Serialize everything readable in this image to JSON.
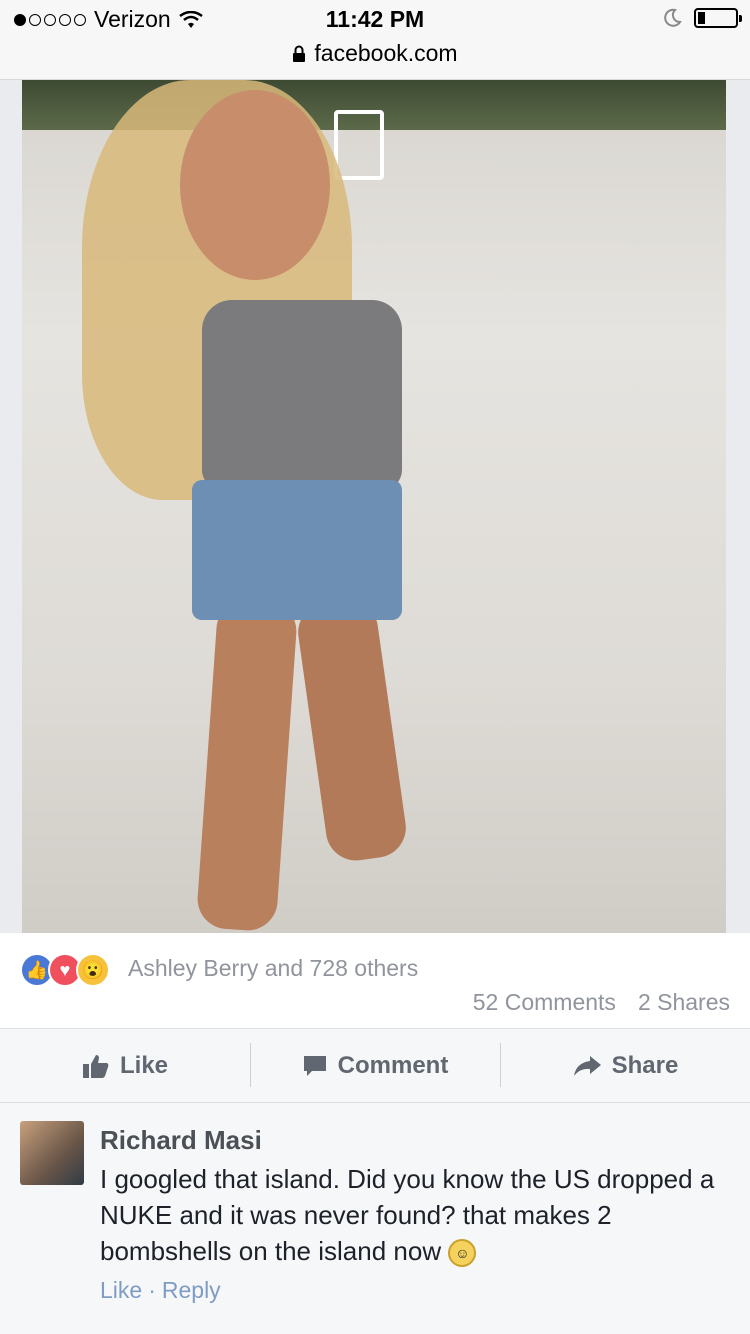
{
  "status_bar": {
    "carrier": "Verizon",
    "time": "11:42 PM",
    "url": "facebook.com",
    "battery_level": 0.2
  },
  "post": {
    "reactions_text": "Ashley Berry and 728 others",
    "comments_count": "52 Comments",
    "shares_count": "2 Shares",
    "actions": {
      "like": "Like",
      "comment": "Comment",
      "share": "Share"
    }
  },
  "comment": {
    "author": "Richard Masi",
    "text": "I googled that island. Did you know the US dropped a NUKE and it was never found? that makes 2 bombshells on the island now",
    "like": "Like",
    "separator": "·",
    "reply": "Reply"
  },
  "colors": {
    "facebook_blue": "#4a78d6",
    "link_blue": "#7f9cc4",
    "gray_text": "#90949c"
  }
}
